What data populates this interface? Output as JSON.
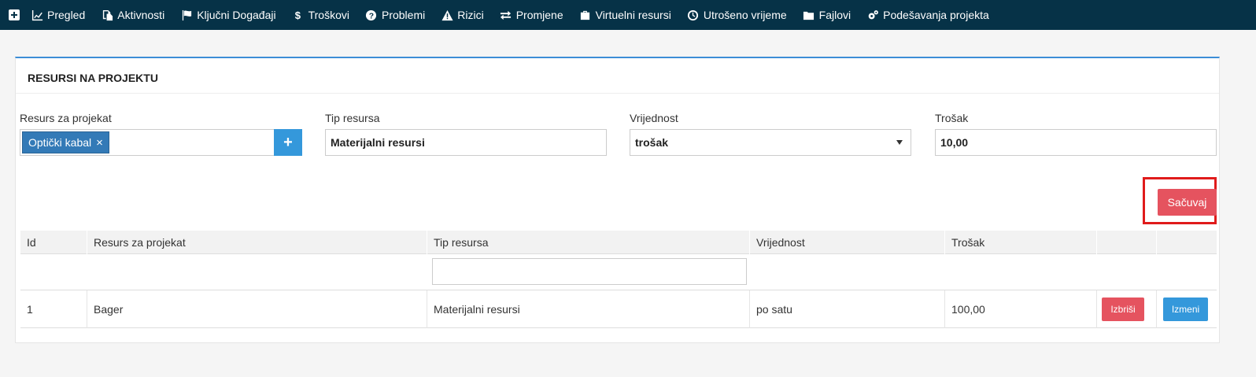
{
  "nav": {
    "items": [
      {
        "label": "Pregled",
        "icon": "line-chart-icon"
      },
      {
        "label": "Aktivnosti",
        "icon": "copy-icon"
      },
      {
        "label": "Ključni Događaji",
        "icon": "flag-icon"
      },
      {
        "label": "Troškovi",
        "icon": "dollar-icon"
      },
      {
        "label": "Problemi",
        "icon": "question-circle-icon"
      },
      {
        "label": "Rizici",
        "icon": "warning-icon"
      },
      {
        "label": "Promjene",
        "icon": "exchange-icon"
      },
      {
        "label": "Virtuelni resursi",
        "icon": "briefcase-icon"
      },
      {
        "label": "Utrošeno vrijeme",
        "icon": "clock-icon"
      },
      {
        "label": "Fajlovi",
        "icon": "folder-icon"
      },
      {
        "label": "Podešavanja projekta",
        "icon": "cogs-icon"
      }
    ]
  },
  "panel": {
    "title": "RESURSI NA PROJEKTU",
    "fields": {
      "resource": {
        "label": "Resurs za projekat",
        "tag": "Optički kabal",
        "tag_remove": "×",
        "add": "+"
      },
      "type": {
        "label": "Tip resursa",
        "value": "Materijalni resursi"
      },
      "value": {
        "label": "Vrijednost",
        "value": "trošak"
      },
      "cost": {
        "label": "Trošak",
        "value": "10,00"
      }
    },
    "save_label": "Sačuvaj"
  },
  "table": {
    "headers": {
      "id": "Id",
      "resource": "Resurs za projekat",
      "type": "Tip resursa",
      "value": "Vrijednost",
      "cost": "Trošak"
    },
    "rows": [
      {
        "id": "1",
        "resource": "Bager",
        "type": "Materijalni resursi",
        "value": "po satu",
        "cost": "100,00",
        "delete_label": "Izbriši",
        "edit_label": "Izmeni"
      }
    ]
  },
  "colors": {
    "nav_bg": "#063247",
    "accent_blue": "#3498db",
    "danger_red": "#e5535f",
    "highlight_outline": "#e01b1b"
  }
}
